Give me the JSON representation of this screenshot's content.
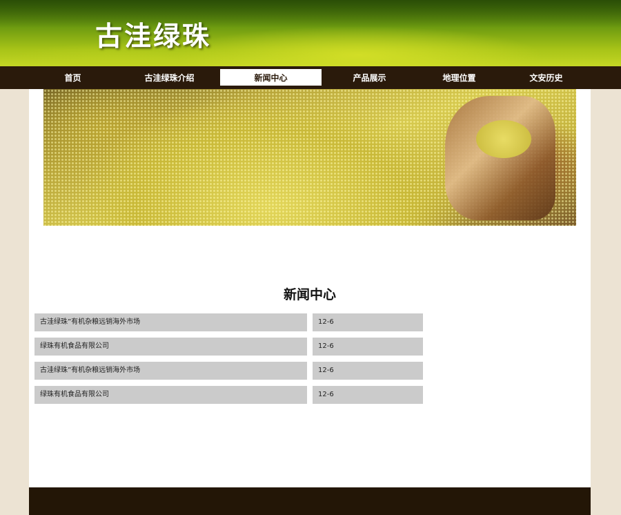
{
  "header": {
    "site_title": "古洼绿珠"
  },
  "nav": {
    "items": [
      {
        "label": "首页"
      },
      {
        "label": "古洼绿珠介绍"
      },
      {
        "label": "新闻中心"
      },
      {
        "label": "产品展示"
      },
      {
        "label": "地理位置"
      },
      {
        "label": "文安历史"
      }
    ],
    "active_index": 2
  },
  "news": {
    "heading": "新闻中心",
    "rows": [
      {
        "title": "古洼绿珠”有机杂粮远销海外市场",
        "date": "12-6"
      },
      {
        "title": "绿珠有机食品有限公司",
        "date": "12-6"
      },
      {
        "title": "古洼绿珠”有机杂粮远销海外市场",
        "date": "12-6"
      },
      {
        "title": "绿珠有机食品有限公司",
        "date": "12-6"
      }
    ]
  },
  "colors": {
    "nav_bg": "#2a1a0b",
    "page_bg": "#ece3d3",
    "row_bg": "#cbcbcb",
    "footer_bg": "#231606"
  }
}
